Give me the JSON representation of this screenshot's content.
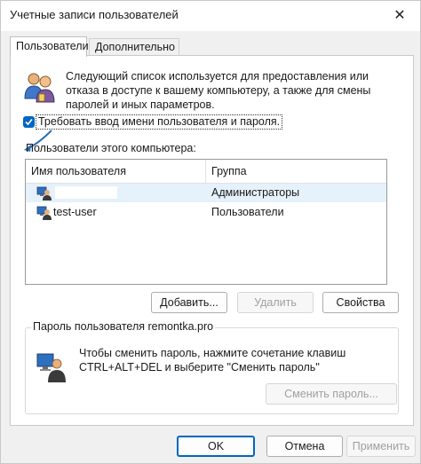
{
  "window": {
    "title": "Учетные записи пользователей",
    "close_glyph": "✕"
  },
  "tabs": [
    {
      "label": "Пользователи",
      "active": true
    },
    {
      "label": "Дополнительно",
      "active": false
    }
  ],
  "info": {
    "icon": "users-icon",
    "text": "Следующий список используется для предоставления или отказа в доступе к вашему компьютеру, а также для смены паролей и иных параметров."
  },
  "require_login": {
    "label": "Требовать ввод имени пользователя и пароля.",
    "checked": true
  },
  "users_list": {
    "label": "Пользователи этого компьютера:",
    "columns": [
      "Имя пользователя",
      "Группа"
    ],
    "rows": [
      {
        "name": "",
        "group": "Администраторы",
        "selected": true
      },
      {
        "name": "test-user",
        "group": "Пользователи",
        "selected": false
      }
    ]
  },
  "list_buttons": {
    "add": "Добавить...",
    "remove": "Удалить",
    "properties": "Свойства"
  },
  "password_group": {
    "title": "Пароль пользователя remontka.pro",
    "text": "Чтобы сменить пароль, нажмите сочетание клавиш CTRL+ALT+DEL и выберите \"Сменить пароль\"",
    "change_button": "Сменить пароль..."
  },
  "dialog_buttons": {
    "ok": "OK",
    "cancel": "Отмена",
    "apply": "Применить"
  },
  "colors": {
    "accent": "#0067c0",
    "selection": "#e5f1fb"
  }
}
